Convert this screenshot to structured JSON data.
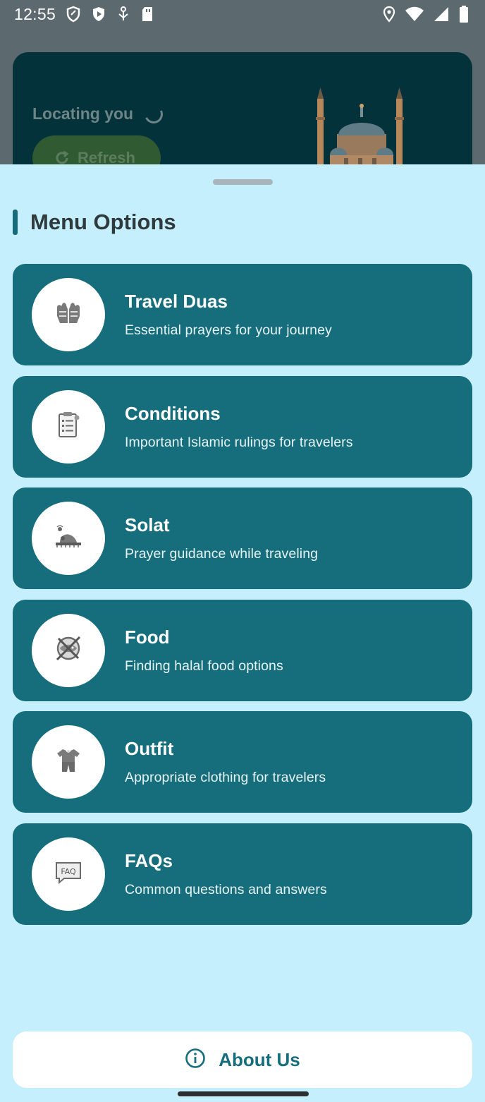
{
  "status_bar": {
    "time": "12:55",
    "left_icons": [
      "shield-icon",
      "play-protect-icon",
      "usb-icon",
      "sd-card-icon"
    ],
    "right_icons": [
      "location-icon",
      "wifi-icon",
      "signal-icon",
      "battery-icon"
    ]
  },
  "header_card": {
    "locating_text": "Locating you",
    "refresh_label": "Refresh"
  },
  "sheet": {
    "section_title": "Menu Options",
    "items": [
      {
        "title": "Travel Duas",
        "subtitle": "Essential prayers for your journey",
        "icon": "praying-hands-icon"
      },
      {
        "title": "Conditions",
        "subtitle": "Important Islamic rulings for travelers",
        "icon": "clipboard-icon"
      },
      {
        "title": "Solat",
        "subtitle": "Prayer guidance while traveling",
        "icon": "prayer-mat-icon"
      },
      {
        "title": "Food",
        "subtitle": "Finding halal food options",
        "icon": "food-icon"
      },
      {
        "title": "Outfit",
        "subtitle": "Appropriate clothing for travelers",
        "icon": "clothing-icon"
      },
      {
        "title": "FAQs",
        "subtitle": "Common questions and answers",
        "icon": "faq-icon"
      }
    ],
    "about_label": "About Us"
  },
  "colors": {
    "sheet_bg": "#c5effc",
    "card_bg": "#166d7c",
    "header_card_bg": "#04323a",
    "title_text": "#2f3a3d"
  }
}
